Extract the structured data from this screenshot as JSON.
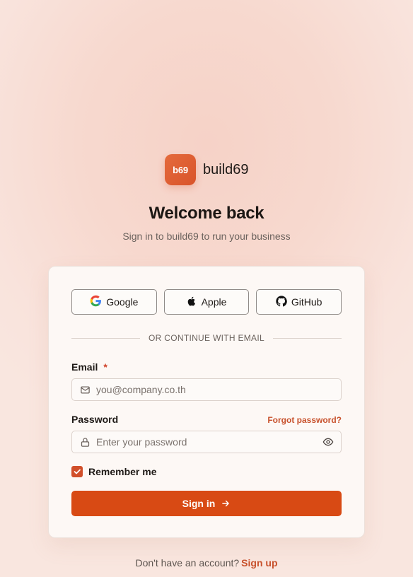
{
  "brand": {
    "logo_text": "b69",
    "name": "build69",
    "accent_color": "#d84a14"
  },
  "header": {
    "title": "Welcome back",
    "subtitle": "Sign in to build69 to run your business"
  },
  "oauth": [
    {
      "label": "Google",
      "icon": "google-icon"
    },
    {
      "label": "Apple",
      "icon": "apple-icon"
    },
    {
      "label": "GitHub",
      "icon": "github-icon"
    }
  ],
  "divider_text": "OR CONTINUE WITH EMAIL",
  "email": {
    "label": "Email",
    "required_mark": "*",
    "placeholder": "you@company.co.th",
    "value": ""
  },
  "password": {
    "label": "Password",
    "placeholder": "Enter your password",
    "value": "",
    "forgot_label": "Forgot password?"
  },
  "remember": {
    "label": "Remember me",
    "checked": true
  },
  "submit_label": "Sign in",
  "footer": {
    "prompt": "Don't have an account?",
    "link_label": "Sign up"
  }
}
